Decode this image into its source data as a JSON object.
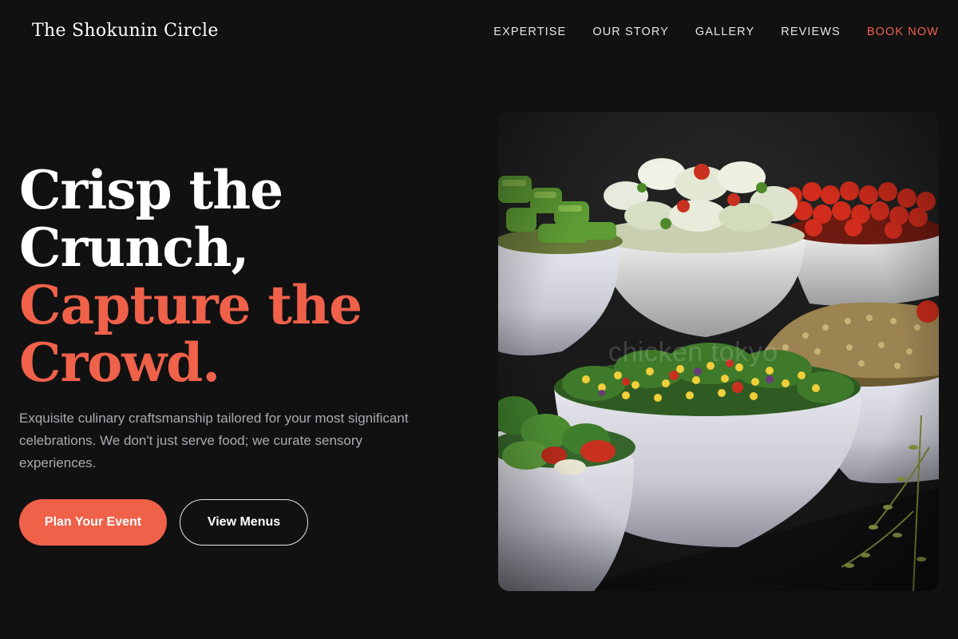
{
  "header": {
    "brand": "The Shokunin Circle",
    "nav": [
      {
        "label": "EXPERTISE"
      },
      {
        "label": "OUR STORY"
      },
      {
        "label": "GALLERY"
      },
      {
        "label": "REVIEWS"
      },
      {
        "label": "BOOK NOW"
      }
    ]
  },
  "hero": {
    "title_line1": "Crisp the",
    "title_line2": "Crunch,",
    "title_line3": "Capture the",
    "title_line4": "Crowd.",
    "description": "Exquisite culinary craftsmanship tailored for your most significant celebrations. We don't just serve food; we curate sensory experiences.",
    "primary_button": "Plan Your Event",
    "secondary_button": "View Menus",
    "image_watermark": "chicken tokyo"
  },
  "colors": {
    "background": "#111112",
    "accent": "#f0614a",
    "text": "#ffffff",
    "muted_text": "#a8abb2"
  }
}
